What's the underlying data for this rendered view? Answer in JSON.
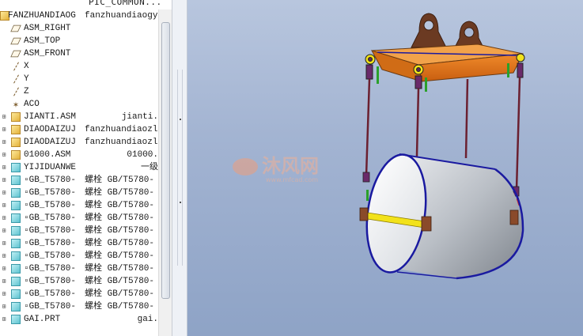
{
  "tree": {
    "header_col2": "PIC_COMMON...",
    "root": {
      "name": "FANZHUANDIAOG",
      "value": "fanzhuandiaogу"
    },
    "rows": [
      {
        "name": "ASM_RIGHT",
        "value": "",
        "icon": "datum-plane-icon",
        "expandable": false
      },
      {
        "name": "ASM_TOP",
        "value": "",
        "icon": "datum-plane-icon",
        "expandable": false
      },
      {
        "name": "ASM_FRONT",
        "value": "",
        "icon": "datum-plane-icon",
        "expandable": false
      },
      {
        "name": "X",
        "value": "",
        "icon": "datum-axis-icon",
        "expandable": false
      },
      {
        "name": "Y",
        "value": "",
        "icon": "datum-axis-icon",
        "expandable": false
      },
      {
        "name": "Z",
        "value": "",
        "icon": "datum-axis-icon",
        "expandable": false
      },
      {
        "name": "ACO",
        "value": "",
        "icon": "coordinate-system-icon",
        "expandable": false
      },
      {
        "name": "JIANTI.ASM",
        "value": "jianti.",
        "icon": "assembly-icon",
        "expandable": true
      },
      {
        "name": "DIAODAIZUJ",
        "value": "fanzhuandiaozl",
        "icon": "assembly-icon",
        "expandable": true
      },
      {
        "name": "DIAODAIZUJ",
        "value": "fanzhuandiaozl",
        "icon": "assembly-icon",
        "expandable": true
      },
      {
        "name": "01000.ASM",
        "value": "01000.",
        "icon": "assembly-icon",
        "expandable": true
      },
      {
        "name": "YIJIDUANWE",
        "value": "一级",
        "icon": "part-icon",
        "expandable": true
      },
      {
        "name": "▫GB_T5780-",
        "value": "螺栓 GB/T5780-",
        "icon": "part-icon",
        "expandable": true
      },
      {
        "name": "▫GB_T5780-",
        "value": "螺栓 GB/T5780-",
        "icon": "part-icon",
        "expandable": true
      },
      {
        "name": "▫GB_T5780-",
        "value": "螺栓 GB/T5780-",
        "icon": "part-icon",
        "expandable": true
      },
      {
        "name": "▫GB_T5780-",
        "value": "螺栓 GB/T5780-",
        "icon": "part-icon",
        "expandable": true
      },
      {
        "name": "▫GB_T5780-",
        "value": "螺栓 GB/T5780-",
        "icon": "part-icon",
        "expandable": true
      },
      {
        "name": "▫GB_T5780-",
        "value": "螺栓 GB/T5780-",
        "icon": "part-icon",
        "expandable": true
      },
      {
        "name": "▫GB_T5780-",
        "value": "螺栓 GB/T5780-",
        "icon": "part-icon",
        "expandable": true
      },
      {
        "name": "▫GB_T5780-",
        "value": "螺栓 GB/T5780-",
        "icon": "part-icon",
        "expandable": true
      },
      {
        "name": "▫GB_T5780-",
        "value": "螺栓 GB/T5780-",
        "icon": "part-icon",
        "expandable": true
      },
      {
        "name": "▫GB_T5780-",
        "value": "螺栓 GB/T5780-",
        "icon": "part-icon",
        "expandable": true
      },
      {
        "name": "▫GB_T5780-",
        "value": "螺栓 GB/T5780-",
        "icon": "part-icon",
        "expandable": true
      },
      {
        "name": "GAI.PRT",
        "value": "gai.",
        "icon": "part-icon",
        "expandable": true
      }
    ]
  },
  "watermark": {
    "text": "沐风网",
    "url": "www.mfcad.com"
  },
  "colors": {
    "viewport_top": "#b8c6de",
    "viewport_bottom": "#8ea3c6",
    "spreader_beam": "#e07a1c",
    "lifting_lug": "#6b3a22",
    "drum_body": "#c9cdd2",
    "drum_rim": "#1a1aa0",
    "strap": "#f2e21a"
  }
}
